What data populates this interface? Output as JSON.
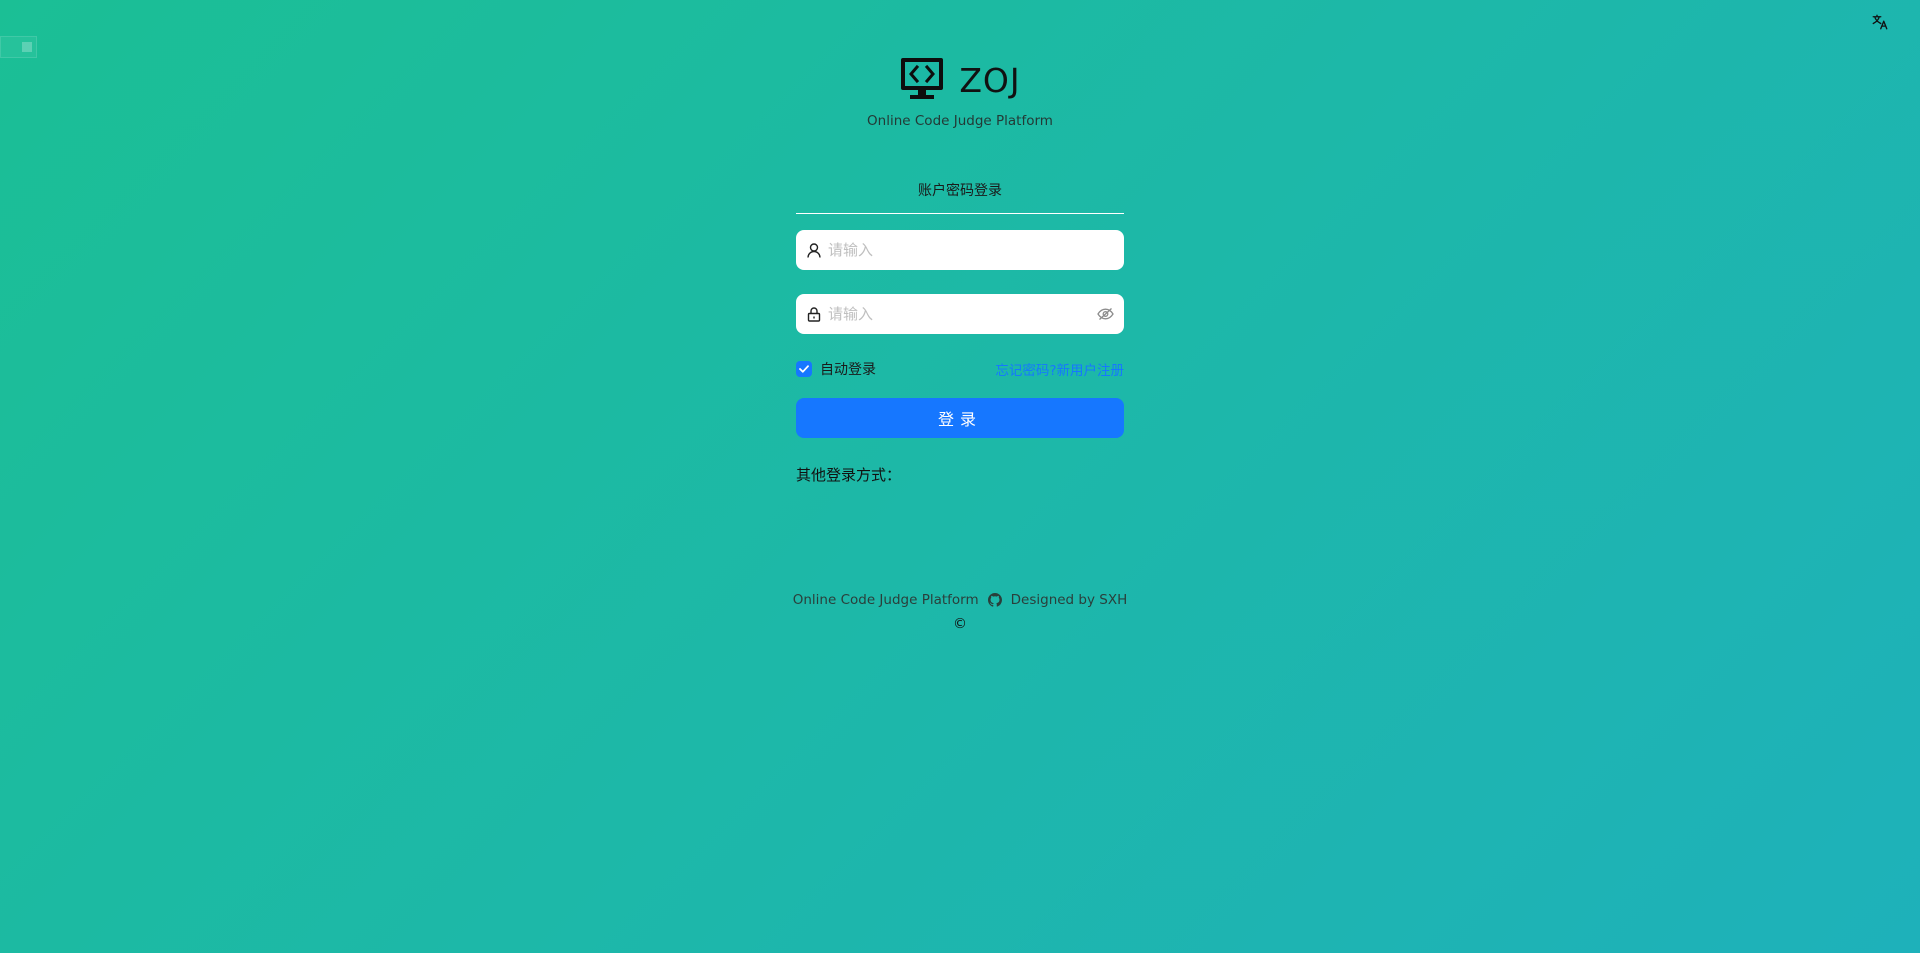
{
  "header": {
    "language_icon": "translate-icon"
  },
  "brand": {
    "logo_icon": "monitor-code-icon",
    "title": "ZOJ",
    "subtitle": "Online Code Judge Platform"
  },
  "login": {
    "tab_label": "账户密码登录",
    "username": {
      "placeholder": "请输入",
      "value": "",
      "icon": "user-icon"
    },
    "password": {
      "placeholder": "请输入",
      "value": "",
      "icon": "lock-icon",
      "toggle_icon": "eye-invisible-icon"
    },
    "remember": {
      "label": "自动登录",
      "checked": true
    },
    "links": {
      "forgot": "忘记密码",
      "separator": "?",
      "register": "新用户注册"
    },
    "submit_label": "登录",
    "other_methods_label": "其他登录方式："
  },
  "footer": {
    "platform": "Online Code Judge Platform",
    "github_icon": "github-icon",
    "designer": "Designed by SXH",
    "copyright": "©"
  },
  "colors": {
    "background_start": "#1bbf95",
    "background_end": "#1eb1ba",
    "primary": "#1677ff"
  }
}
